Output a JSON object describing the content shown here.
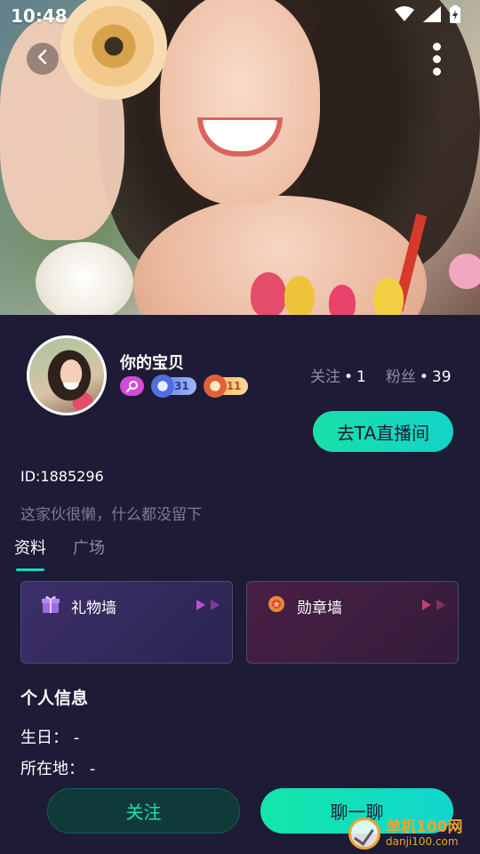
{
  "status_bar": {
    "time": "10:48"
  },
  "profile": {
    "nickname": "你的宝贝",
    "badges": {
      "level_blue": "31",
      "level_orange": "11"
    },
    "following_label": "关注",
    "following_sep": "•",
    "following_count": "1",
    "fans_label": "粉丝",
    "fans_sep": "•",
    "fans_count": "39",
    "live_button": "去TA直播间",
    "id": "ID:1885296",
    "bio": "这家伙很懒，什么都没留下"
  },
  "tabs": [
    {
      "label": "资料"
    },
    {
      "label": "广场"
    }
  ],
  "cards": {
    "gift_wall": "礼物墙",
    "medal_wall": "勋章墙"
  },
  "personal_info": {
    "title": "个人信息",
    "birthday": "生日： -",
    "location": "所在地： -"
  },
  "actions": {
    "follow": "关注",
    "chat": "聊一聊"
  },
  "watermark": {
    "cn": "单机100网",
    "en": "danji100.com"
  },
  "colors": {
    "background": "#1d1b36",
    "accent": "#16d8c4",
    "muted_text": "#8e8aa8"
  }
}
